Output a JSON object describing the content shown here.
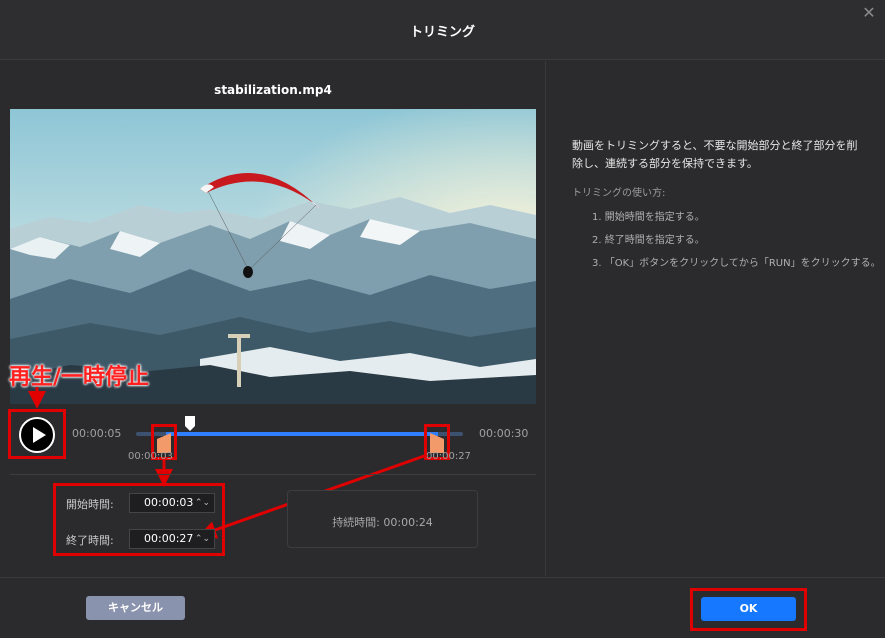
{
  "dialog": {
    "title": "トリミング"
  },
  "player": {
    "filename": "stabilization.mp4",
    "current_time": "00:00:05",
    "total_time": "00:00:30",
    "handle_start_time": "00:00:03",
    "handle_end_time": "00:00:27",
    "playhead_fraction": 0.167,
    "selection_start_fraction": 0.1,
    "selection_end_fraction": 0.9
  },
  "annotation": {
    "play_pause_label": "再生/一時停止"
  },
  "fields": {
    "start_label": "開始時間:",
    "start_value": "00:00:03",
    "end_label": "終了時間:",
    "end_value": "00:00:27",
    "duration_label": "持続時間:",
    "duration_value": "00:00:24"
  },
  "info": {
    "description": "動画をトリミングすると、不要な開始部分と終了部分を削除し、連続する部分を保持できます。",
    "howto_title": "トリミングの使い方:",
    "steps": [
      "1. 開始時間を指定する。",
      "2. 終了時間を指定する。",
      "3. 「OK」ボタンをクリックしてから「RUN」をクリックする。"
    ]
  },
  "buttons": {
    "cancel": "キャンセル",
    "ok": "OK"
  },
  "icons": {
    "close": "close-icon",
    "play": "play-icon",
    "spinner": "spinner-icon"
  },
  "colors": {
    "accent": "#1677ff",
    "annotation": "#e00000",
    "handle": "#f39a6a"
  }
}
